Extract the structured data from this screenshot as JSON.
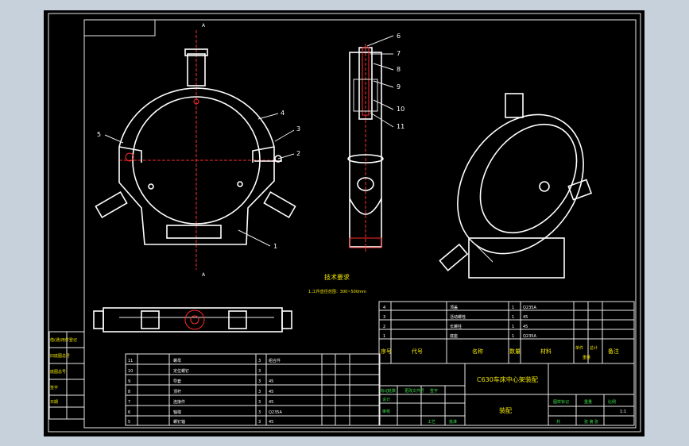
{
  "colors": {
    "page_bg": "#c7d1db",
    "sheet_bg": "#000000",
    "line": "#ffffff",
    "center_line": "#ff2a2a",
    "yellow_text": "#f2e600",
    "green_text": "#3fe04a"
  },
  "view_labels": {
    "section_mark_top": "A",
    "section_mark_bottom": "A"
  },
  "balloons": [
    "1",
    "2",
    "3",
    "4",
    "5",
    "6",
    "7",
    "8",
    "9",
    "10",
    "11"
  ],
  "tech_req": {
    "title": "技术要求",
    "line1": "1.工件直径范围：300~500mm"
  },
  "bom_small": [
    {
      "no": "4",
      "name": "顶盖",
      "qty": "1",
      "material": "Q235A"
    },
    {
      "no": "3",
      "name": "活动螺栓",
      "qty": "1",
      "material": "45"
    },
    {
      "no": "2",
      "name": "长螺柱",
      "qty": "1",
      "material": "45"
    },
    {
      "no": "1",
      "name": "底座",
      "qty": "1",
      "material": "Q235A"
    }
  ],
  "bom_header": {
    "seq": "序号",
    "code": "代号",
    "name": "名称",
    "qty": "数量",
    "material": "材料",
    "single": "单件",
    "total": "总计",
    "weight": "重量",
    "remark": "备注"
  },
  "bom_left": [
    {
      "no": "11",
      "name": "螺母",
      "qty": "3",
      "material": "组合件"
    },
    {
      "no": "10",
      "name": "定位螺钉",
      "qty": "3",
      "material": ""
    },
    {
      "no": "9",
      "name": "导套",
      "qty": "3",
      "material": "45"
    },
    {
      "no": "8",
      "name": "顶杆",
      "qty": "3",
      "material": "45"
    },
    {
      "no": "7",
      "name": "连接件",
      "qty": "3",
      "material": "45"
    },
    {
      "no": "6",
      "name": "轴端",
      "qty": "3",
      "material": "Q235A"
    },
    {
      "no": "5",
      "name": "螺钉轴",
      "qty": "3",
      "material": "45"
    }
  ],
  "title_block": {
    "drawing_title": "C630车床中心架装配",
    "company": "装配",
    "labels": [
      "标记",
      "处数",
      "更改文件号",
      "签字",
      "设计",
      "审核",
      "工艺",
      "批准"
    ],
    "stage": "图样标记",
    "weight": "重量",
    "scale": "比例",
    "scale_value": "1:1",
    "sheet": "共",
    "sheet_of": "张 第 张"
  },
  "side_labels": [
    "借(通)用件登记",
    "旧底图总号",
    "底图总号",
    "签字",
    "日期"
  ]
}
